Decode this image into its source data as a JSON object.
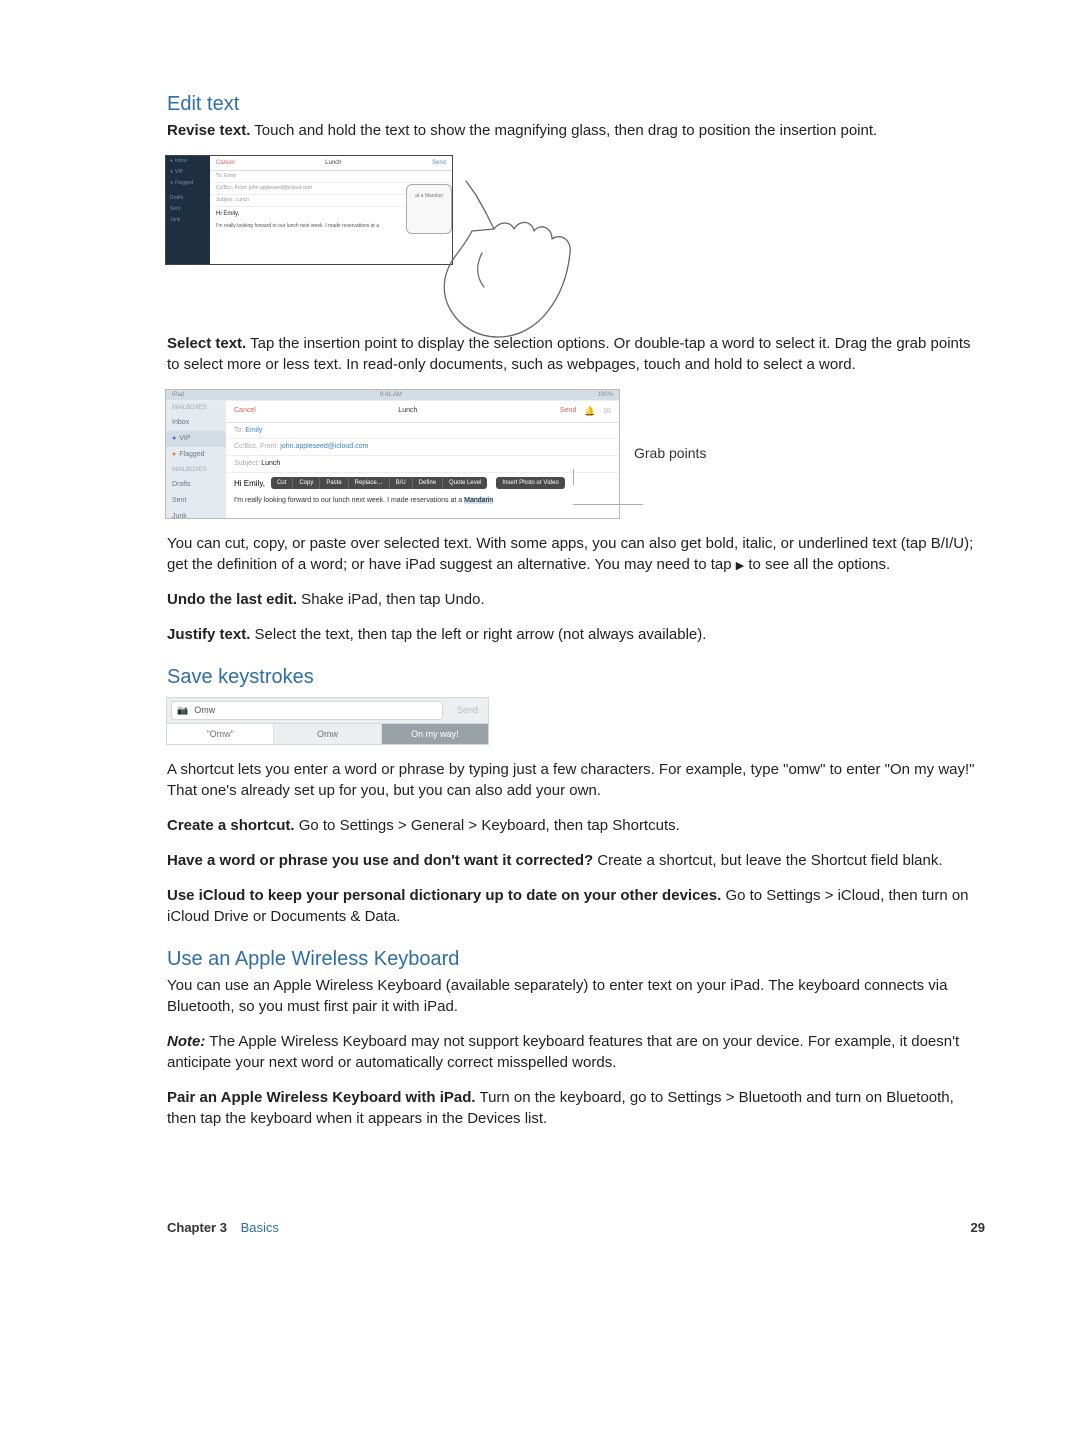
{
  "sections": {
    "editText": "Edit text",
    "saveKeys": "Save keystrokes",
    "wireless": "Use an Apple Wireless Keyboard"
  },
  "para": {
    "revise_lead": "Revise text.",
    "revise_body": " Touch and hold the text to show the magnifying glass, then drag to position the insertion point.",
    "select_lead": "Select text.",
    "select_body": " Tap the insertion point to display the selection options. Or double-tap a word to select it. Drag the grab points to select more or less text. In read-only documents, such as webpages, touch and hold to select a word.",
    "cut_body_a": "You can cut, copy, or paste over selected text. With some apps, you can also get bold, italic, or underlined text (tap B/I/U); get the definition of a word; or have iPad suggest an alternative. You may need to tap ",
    "cut_body_b": " to see all the options.",
    "undo_lead": "Undo the last edit.",
    "undo_body": " Shake iPad, then tap Undo.",
    "justify_lead": "Justify text.",
    "justify_body": " Select the text, then tap the left or right arrow (not always available).",
    "shortcut_body": "A shortcut lets you enter a word or phrase by typing just a few characters. For example, type \"omw\" to enter \"On my way!\" That one's already set up for you, but you can also add your own.",
    "create_lead": "Create a shortcut.",
    "create_body": " Go to Settings > General > Keyboard, then tap Shortcuts.",
    "dont_lead": "Have a word or phrase you use and don't want it corrected?",
    "dont_body": " Create a shortcut, but leave the Shortcut field blank.",
    "icloud_lead": "Use iCloud to keep your personal dictionary up to date on your other devices.",
    "icloud_body": " Go to Settings > iCloud, then turn on iCloud Drive or Documents & Data.",
    "wk_body1": "You can use an Apple Wireless Keyboard (available separately) to enter text on your iPad. The keyboard connects via Bluetooth, so you must first pair it with iPad.",
    "note_lead": "Note:",
    "note_body": "  The Apple Wireless Keyboard may not support keyboard features that are on your device. For example, it doesn't anticipate your next word or automatically correct misspelled words.",
    "pair_lead": "Pair an Apple Wireless Keyboard with iPad.",
    "pair_body": " Turn on the keyboard, go to Settings > Bluetooth and turn on Bluetooth, then tap the keyboard when it appears in the Devices list."
  },
  "triangle": "▶",
  "shot1": {
    "cancel": "Cancel",
    "title": "Lunch",
    "send": "Send",
    "to": "To: Emily",
    "cc": "Cc/Bcc, From: john.appleseed@icloud.com",
    "subject": "Subject: Lunch",
    "hi": "Hi Emily,",
    "line": "I'm really looking forward to our lunch next week. I made reservations at a ",
    "loupe": "at a Mandari",
    "side": [
      "Inbox",
      "VIP",
      "Flagged",
      "",
      "Drafts",
      "Sent",
      "Junk"
    ]
  },
  "shot2": {
    "status_l": "iPad ",
    "status_c": "9:41 AM",
    "status_r": "100% ",
    "side_inbox": "Inbox",
    "side_vip": "VIP",
    "side_flag": "Flagged",
    "side_mail": "MAILBOXES",
    "side_drafts": "Drafts",
    "side_sent": "Sent",
    "side_junk": "Junk",
    "cancel": "Cancel",
    "title": "Lunch",
    "send": "Send",
    "to_lbl": "To: ",
    "to_val": "Emily",
    "cc_lbl": "Cc/Bcc, From: ",
    "cc_val": "john.appleseed@icloud.com",
    "sub_lbl": "Subject: ",
    "sub_val": "Lunch",
    "hi": "Hi Emily,",
    "menu": [
      "Cut",
      "Copy",
      "Paste",
      "Replace…",
      "B/U",
      "Define",
      "Quote Level"
    ],
    "menu2": "Insert Photo or Video",
    "line_a": "I'm really looking forward to our lunch next week. I made reservations at a ",
    "line_sel": "Mandarin",
    "callout": "Grab points"
  },
  "shot3": {
    "input": "Omw",
    "send": "Send",
    "s1": "\"Omw\"",
    "s2": "Omw",
    "s3": "On my way!"
  },
  "footer": {
    "chapter": "Chapter  3",
    "basics": "Basics",
    "page": "29"
  }
}
